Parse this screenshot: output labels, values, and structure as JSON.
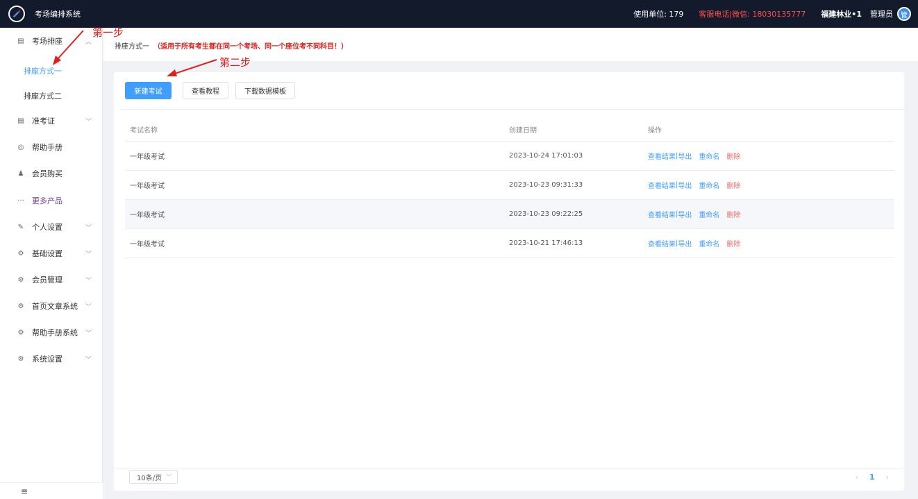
{
  "topbar": {
    "app_title": "考场编排系统",
    "usage": "使用单位: 179",
    "service": "客服电话|微信: 18030135777",
    "org": "福建林业•1",
    "user": "管理员",
    "avatar_text": "管"
  },
  "sidebar": {
    "exam_seating": "考场排座",
    "sub_method_one": "排座方式一",
    "sub_method_two": "排座方式二",
    "admission_ticket": "准考证",
    "help_manual": "帮助手册",
    "member_purchase": "会员购买",
    "more_products": "更多产品",
    "personal_settings": "个人设置",
    "basic_settings": "基础设置",
    "member_management": "会员管理",
    "home_article_system": "首页文章系统",
    "help_manual_system": "帮助手册系统",
    "system_settings": "系统设置",
    "footer_icon": "≡"
  },
  "header": {
    "method": "排座方式一",
    "note": "（适用于所有考生都在同一个考场、同一个座位考不同科目！）"
  },
  "toolbar": {
    "new_exam": "新建考试",
    "view_tutorial": "查看教程",
    "download_template": "下载数据模板"
  },
  "table": {
    "columns": [
      "考试名称",
      "创建日期",
      "操作"
    ],
    "rows": [
      {
        "name": "一年级考试",
        "date": "2023-10-24 17:01:03"
      },
      {
        "name": "一年级考试",
        "date": "2023-10-23 09:31:33"
      },
      {
        "name": "一年级考试",
        "date": "2023-10-23 09:22:25"
      },
      {
        "name": "一年级考试",
        "date": "2023-10-21 17:46:13"
      }
    ],
    "ops": {
      "view_result": "查看结果",
      "separator": "|",
      "export": "导出",
      "rename": "重命名",
      "delete": "删除"
    }
  },
  "pagination": {
    "page_size": "10条/页",
    "current_page": "1",
    "prev": "‹",
    "next": "›"
  },
  "annotations": {
    "step_one": "第一步",
    "step_two": "第二步"
  },
  "colors": {
    "topbar_bg": "#121a2b",
    "primary": "#409eff",
    "danger": "#f56c6c",
    "annotation": "#e0201d"
  }
}
